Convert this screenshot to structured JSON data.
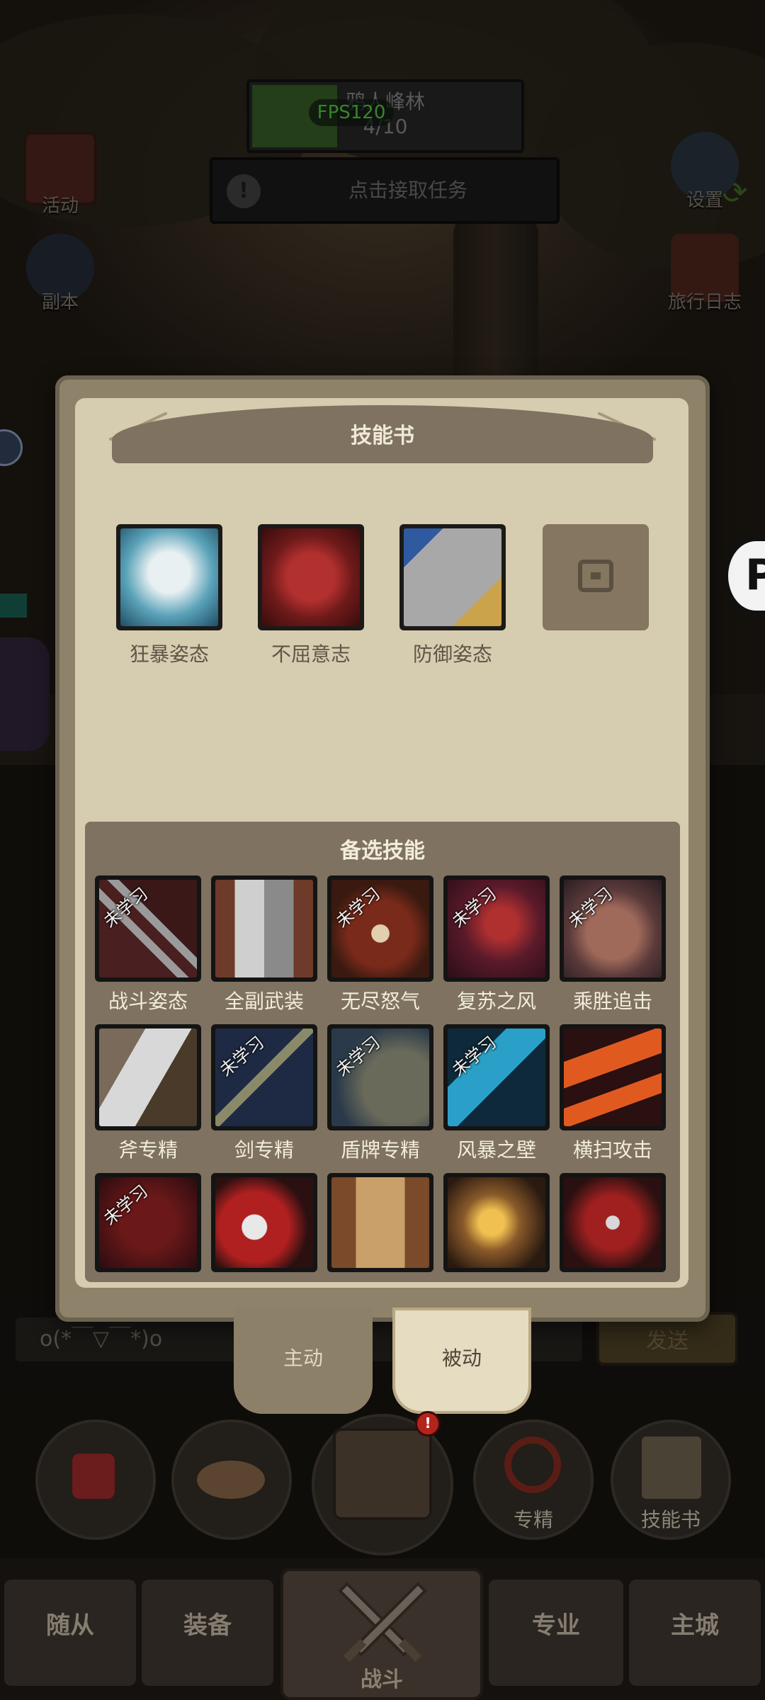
{
  "quest": {
    "name": "鸦人峰林",
    "progress": "4/10",
    "fps": "FPS120",
    "task_prompt": "点击接取任务"
  },
  "side_buttons": {
    "activity": "活动",
    "dungeon": "副本",
    "settings": "设置",
    "travel_log": "旅行日志"
  },
  "skill_book": {
    "title": "技能书",
    "equipped": [
      {
        "name": "狂暴姿态",
        "icon": "berserker-stance-icon"
      },
      {
        "name": "不屈意志",
        "icon": "fist-icon"
      },
      {
        "name": "防御姿态",
        "icon": "shield-icon"
      }
    ],
    "candidates_title": "备选技能",
    "unlearned_label": "未学习",
    "candidates": [
      {
        "name": "战斗姿态",
        "unlearned": true
      },
      {
        "name": "全副武装",
        "unlearned": false
      },
      {
        "name": "无尽怒气",
        "unlearned": true
      },
      {
        "name": "复苏之风",
        "unlearned": true
      },
      {
        "name": "乘胜追击",
        "unlearned": true
      },
      {
        "name": "斧专精",
        "unlearned": false
      },
      {
        "name": "剑专精",
        "unlearned": true
      },
      {
        "name": "盾牌专精",
        "unlearned": true
      },
      {
        "name": "风暴之壁",
        "unlearned": true
      },
      {
        "name": "横扫攻击",
        "unlearned": false
      },
      {
        "name": "",
        "unlearned": true
      },
      {
        "name": "",
        "unlearned": false
      },
      {
        "name": "",
        "unlearned": false
      },
      {
        "name": "",
        "unlearned": false
      },
      {
        "name": "",
        "unlearned": false
      }
    ]
  },
  "tabs": {
    "active": "主动",
    "passive": "被动",
    "selected": "被动"
  },
  "chat": {
    "input_value": "o(*￣▽￣*)o",
    "send": "发送"
  },
  "actions": {
    "specialization": "专精",
    "skill_book": "技能书"
  },
  "nav": {
    "followers": "随从",
    "equipment": "装备",
    "battle": "战斗",
    "profession": "专业",
    "main_city": "主城"
  },
  "colors": {
    "paper": "#d6ccb0",
    "panel_frame": "#8e826a",
    "fps_green": "#5fe04a",
    "alert_red": "#b3251c"
  }
}
